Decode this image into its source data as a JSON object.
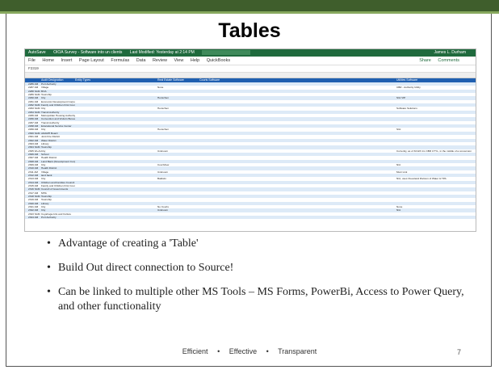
{
  "slide": {
    "title": "Tables",
    "bullets": [
      "Advantage of creating a 'Table'",
      "Build Out direct connection to Source!",
      "Can be linked to multiple other MS Tools – MS Forms, PowerBi, Access to Power Query, and other functionality"
    ],
    "footer": [
      "Efficient",
      "Effective",
      "Transparent"
    ],
    "page_number": "7"
  },
  "excel": {
    "titlebar": {
      "autosave": "AutoSave",
      "filename": "OIOA Survey - Software into un clients",
      "saved": "Last Modified: Yesterday at 2:14 PM",
      "search": "Search (Alt+Q)",
      "user": "James L. Durham"
    },
    "menu": [
      "File",
      "Home",
      "Insert",
      "Page Layout",
      "Formulas",
      "Data",
      "Review",
      "View",
      "Help",
      "QuickBooks"
    ],
    "share": "Share",
    "comments": "Comments",
    "name_box": "F2319",
    "columns": [
      "A",
      "B",
      "C",
      "D",
      "E",
      "F"
    ],
    "headers": [
      "Audit Designation",
      "Entity Types",
      "Real Estate Software",
      "Courts Software",
      "",
      "Utilities Software"
    ],
    "rows": [
      [
        "2286 AM",
        "Port Authority",
        "",
        "",
        "",
        ""
      ],
      [
        "2287 AM",
        "Village",
        "",
        "None",
        "",
        "CBR - Authority Utility"
      ],
      [
        "2288 SAM",
        "BOA",
        "",
        "",
        "",
        ""
      ],
      [
        "2289 SAM",
        "Township",
        "",
        "",
        "",
        ""
      ],
      [
        "2290 AM",
        "City",
        "",
        "Henschen",
        "",
        "SGI VIP"
      ],
      [
        "2291 AM",
        "Economic Development Corporation",
        "",
        "",
        "",
        ""
      ],
      [
        "2292 SAM",
        "Family and Children First Council",
        "",
        "",
        "",
        ""
      ],
      [
        "2293 SAM",
        "City",
        "",
        "Henschen",
        "",
        "Software Solutions"
      ],
      [
        "2294 SAM",
        "Transit Authority",
        "",
        "",
        "",
        ""
      ],
      [
        "2295 AM",
        "Metropolitan Housing Authority",
        "",
        "",
        "",
        ""
      ],
      [
        "2296 AM",
        "Convention and Visitors Bureau",
        "",
        "",
        "",
        ""
      ],
      [
        "2297 AM",
        "Transit Authority",
        "",
        "",
        "",
        ""
      ],
      [
        "2298 AM",
        "Educational Service Center",
        "",
        "",
        "",
        ""
      ],
      [
        "2299 AM",
        "City",
        "",
        "Henschen",
        "",
        "SGI"
      ],
      [
        "2300 SAM",
        "ADAMH Board",
        "",
        "",
        "",
        ""
      ],
      [
        "2301 AM",
        "Joint Fire District",
        "",
        "",
        "",
        ""
      ],
      [
        "2302 AM",
        "Water District",
        "",
        "",
        "",
        ""
      ],
      [
        "2303 AM",
        "Library",
        "",
        "",
        "",
        ""
      ],
      [
        "2304 SAM",
        "Township",
        "",
        "",
        "",
        ""
      ],
      [
        "2305 FA-AUTL",
        "City",
        "",
        "Unknown",
        "",
        "Currently, as of 3/1/23 it is CBR UTYL, in the middle of a conversion"
      ],
      [
        "2306 AM",
        "School",
        "",
        "",
        "",
        ""
      ],
      [
        "2307 AM",
        "Health District",
        "",
        "",
        "",
        ""
      ],
      [
        "2308 AM",
        "Land Bank (Development Corporation)",
        "",
        "",
        "",
        ""
      ],
      [
        "2309 AM",
        "City",
        "",
        "CourtView",
        "",
        "N/A"
      ],
      [
        "2310 AM",
        "Health District",
        "",
        "",
        "",
        ""
      ],
      [
        "2311 AM",
        "Village",
        "",
        "Unknown",
        "",
        "Muni Link"
      ],
      [
        "2312 AM",
        "land bank",
        "",
        "",
        "",
        ""
      ],
      [
        "2313 AM",
        "City",
        "",
        "Baldwin",
        "",
        "N/A, uses Cleveland Division of Water & TPA"
      ],
      [
        "2314 AM",
        "Children and Families Council",
        "",
        "",
        "",
        ""
      ],
      [
        "2315 AM",
        "Family and Children First Council",
        "",
        "",
        "",
        ""
      ],
      [
        "2316 SAM",
        "Council of Governments",
        "",
        "",
        "",
        ""
      ],
      [
        "2317 AM",
        "MHA",
        "",
        "",
        "",
        ""
      ],
      [
        "2318 SAM",
        "Township",
        "",
        "",
        "",
        ""
      ],
      [
        "2319 AM",
        "Township",
        "",
        "",
        "",
        ""
      ],
      [
        "2320 AM",
        "Library",
        "",
        "",
        "",
        ""
      ],
      [
        "2321 AM",
        "City",
        "",
        "No Courts",
        "",
        "None"
      ],
      [
        "2322 AM",
        "City",
        "",
        "Unknown",
        "",
        "N/A"
      ],
      [
        "2323 SAM",
        "Cuyahoga Arts and Culture",
        "",
        "",
        "",
        ""
      ],
      [
        "2324 AM",
        "Port Authority",
        "",
        "",
        "",
        ""
      ]
    ]
  },
  "colors": {
    "header_bar": "#3f5e2c",
    "accent_line": "#87a85e",
    "excel_green": "#1f6a3d",
    "table_header": "#1f5fb0",
    "band": "#ddeaf7"
  }
}
